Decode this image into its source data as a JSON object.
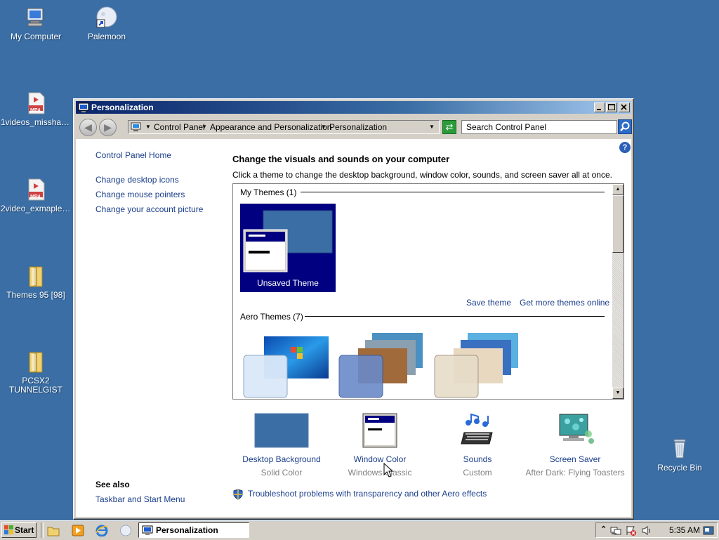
{
  "desktop": {
    "icons": [
      {
        "label": "My Computer"
      },
      {
        "label": "Palemoon"
      },
      {
        "label": "1videos_missha_p..."
      },
      {
        "label": "2video_exmaple_..."
      },
      {
        "label": "Themes 95 [98]"
      },
      {
        "label": "PCSX2 TUNNELGIST"
      },
      {
        "label": "Recycle Bin"
      }
    ],
    "file_badge": "MP4"
  },
  "window": {
    "title": "Personalization",
    "breadcrumbs": [
      "Control Panel",
      "Appearance and Personalization",
      "Personalization"
    ],
    "search_placeholder": "Search Control Panel"
  },
  "sidebar": {
    "home": "Control Panel Home",
    "links": [
      "Change desktop icons",
      "Change mouse pointers",
      "Change your account picture"
    ],
    "see_also_title": "See also",
    "see_also_links": [
      "Taskbar and Start Menu"
    ]
  },
  "main": {
    "heading": "Change the visuals and sounds on your computer",
    "subheading": "Click a theme to change the desktop background, window color, sounds, and screen saver all at once.",
    "my_themes_header": "My Themes (1)",
    "unsaved_theme": "Unsaved Theme",
    "save_theme": "Save theme",
    "get_more_themes": "Get more themes online",
    "aero_themes_header": "Aero Themes (7)",
    "bottom_items": [
      {
        "title": "Desktop Background",
        "subtitle": "Solid Color"
      },
      {
        "title": "Window Color",
        "subtitle": "Windows Classic"
      },
      {
        "title": "Sounds",
        "subtitle": "Custom"
      },
      {
        "title": "Screen Saver",
        "subtitle": "After Dark: Flying Toasters"
      }
    ],
    "troubleshoot": "Troubleshoot problems with transparency and other Aero effects"
  },
  "taskbar": {
    "start": "Start",
    "task_title": "Personalization",
    "clock": "5:35 AM"
  },
  "colors": {
    "desktop": "#3a6ea5",
    "theme_selected": "#000080",
    "link": "#1a3e8a"
  }
}
